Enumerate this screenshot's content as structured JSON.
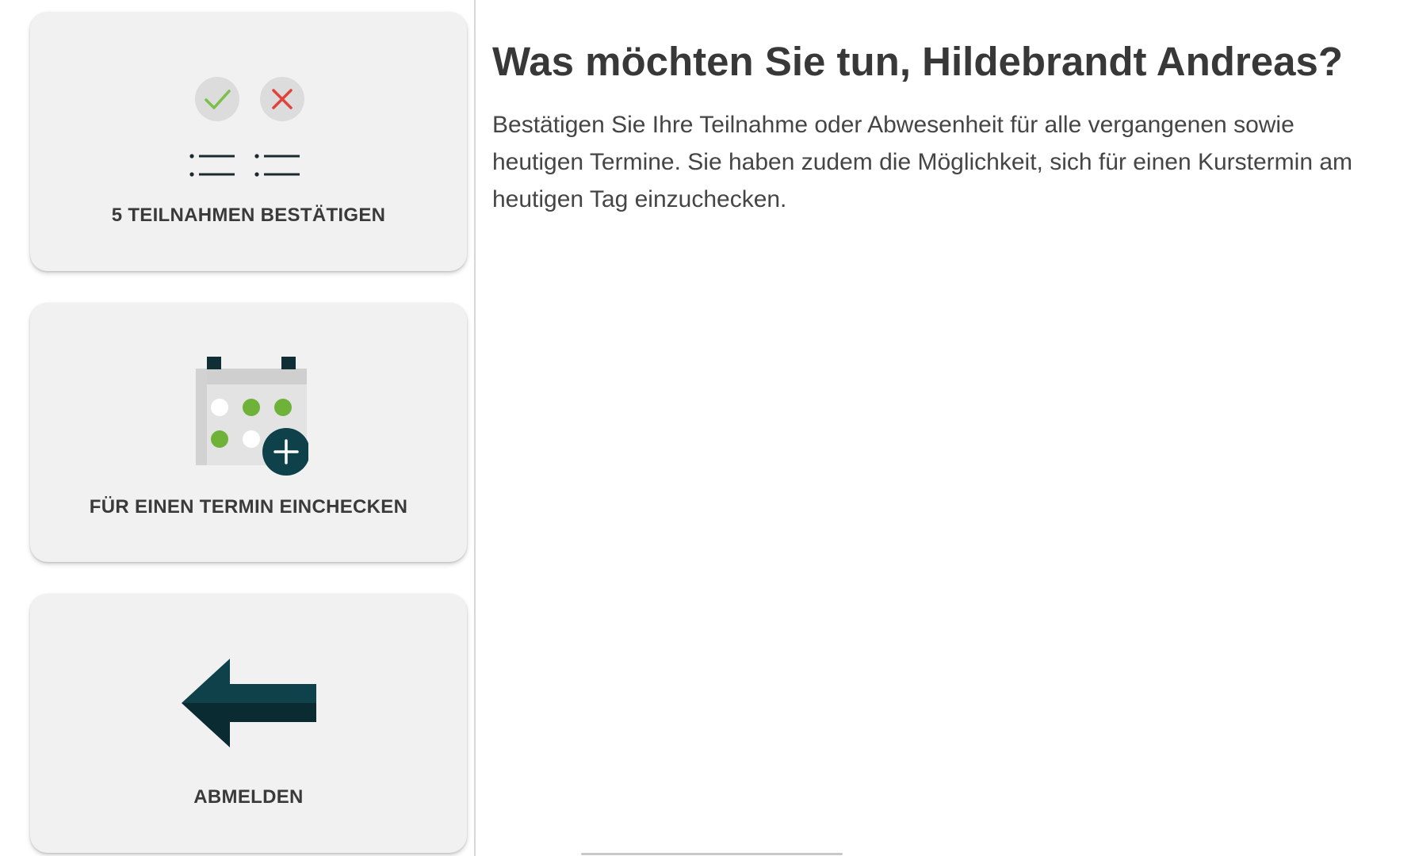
{
  "sidebar": {
    "cards": [
      {
        "label": "5 TEILNAHMEN BESTÄTIGEN",
        "icon": "confirm-attendance-icon"
      },
      {
        "label": "FÜR EINEN TERMIN EINCHECKEN",
        "icon": "calendar-add-icon"
      },
      {
        "label": "ABMELDEN",
        "icon": "arrow-left-icon"
      }
    ]
  },
  "main": {
    "title": "Was möchten Sie tun, Hildebrandt Andreas?",
    "description": "Bestätigen Sie Ihre Teilnahme oder Abwesenheit für alle vergangenen sowie heutigen Termine. Sie haben zudem die Möglichkeit, sich für einen Kurstermin am heutigen Tag einzuchecken."
  },
  "colors": {
    "accent_dark": "#0e4149",
    "success_green": "#6fb23a",
    "danger_red": "#e0433a",
    "card_bg": "#f1f1f1",
    "text_dark": "#3a3a3a"
  }
}
